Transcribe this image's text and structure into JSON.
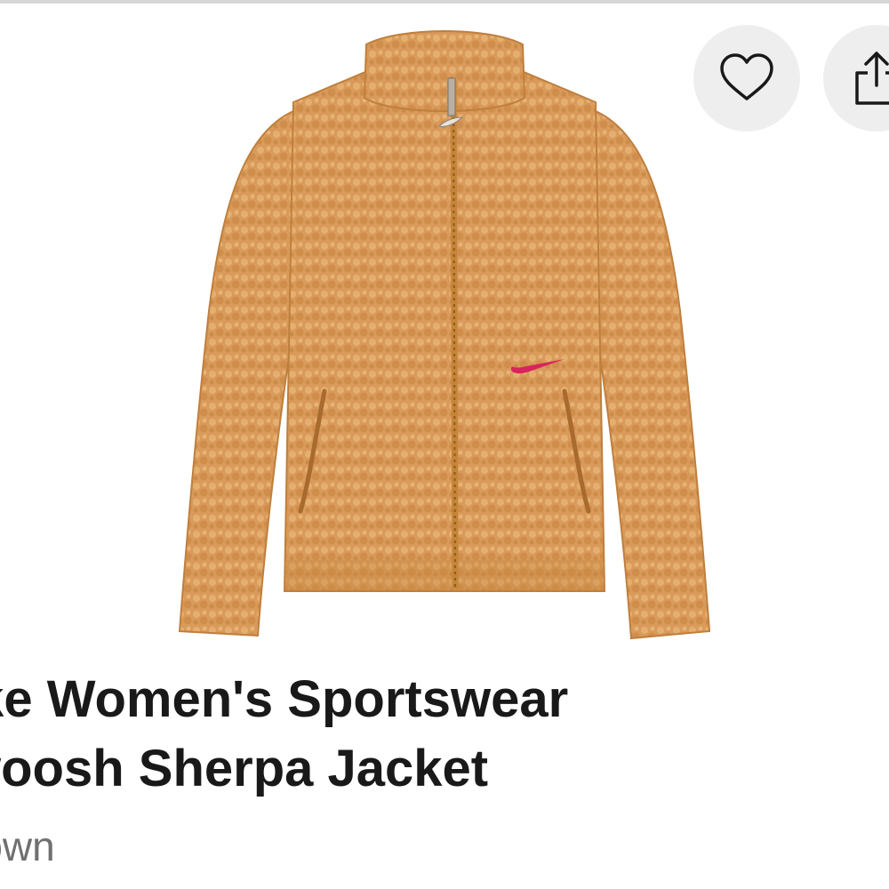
{
  "product": {
    "title_line1": "ike Women's Sportswear",
    "title_line2": "woosh Sherpa Jacket",
    "color": "rown",
    "image_icon": "sherpa-jacket-photo",
    "swoosh_color": "#d8245d",
    "fabric_color": "#d99a5a"
  },
  "actions": {
    "favorite_icon": "heart-icon",
    "share_icon": "share-icon"
  }
}
